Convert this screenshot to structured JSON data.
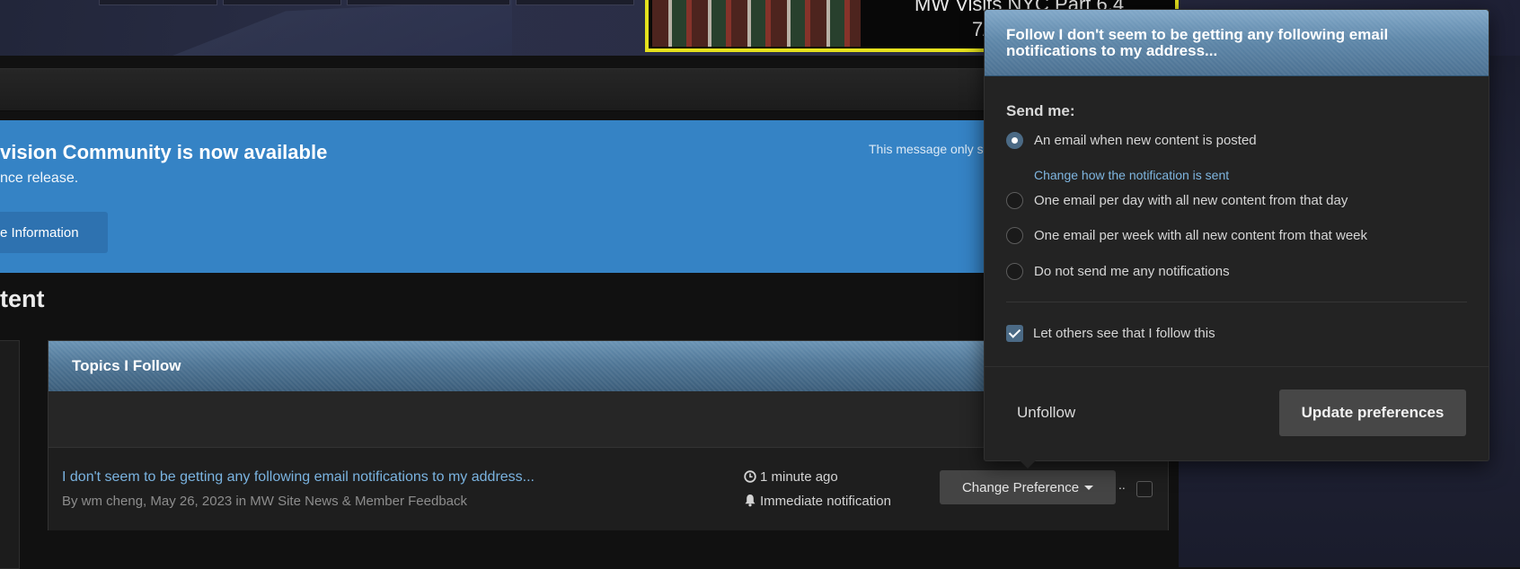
{
  "header": {
    "ad_title": "MW Visits NYC Part 6.4",
    "ad_subtitle": "7/"
  },
  "announcement": {
    "title": "vision Community is now available",
    "subtitle": "nce release.",
    "button_label": "e Information",
    "note": "This message only s",
    "bg_color": "#3583c5"
  },
  "page": {
    "heading": "tent"
  },
  "topics": {
    "title": "Topics I Follow",
    "rows": [
      {
        "title": "I don't seem to be getting any following email notifications to my address...",
        "meta": "By wm cheng, May 26, 2023 in MW Site News & Member Feedback",
        "time": "1 minute ago",
        "notification": "Immediate notification",
        "pref_button": "Change Preference",
        "dots": ".."
      }
    ]
  },
  "follow_popup": {
    "title": "Follow I don't seem to be getting any following email notifications to my address...",
    "send_me_label": "Send me:",
    "options": [
      {
        "label": "An email when new content is posted",
        "selected": true
      },
      {
        "label": "One email per day with all new content from that day",
        "selected": false
      },
      {
        "label": "One email per week with all new content from that week",
        "selected": false
      },
      {
        "label": "Do not send me any notifications",
        "selected": false
      }
    ],
    "change_link": "Change how the notification is sent",
    "let_others_label": "Let others see that I follow this",
    "let_others_checked": true,
    "unfollow_label": "Unfollow",
    "update_label": "Update preferences"
  },
  "colors": {
    "accent": "#3583c5",
    "link": "#7ab3e0",
    "highlight_border": "#e5e11d"
  },
  "icons": [
    "clock-icon",
    "bell-icon",
    "caret-down-icon",
    "checkmark-icon"
  ]
}
